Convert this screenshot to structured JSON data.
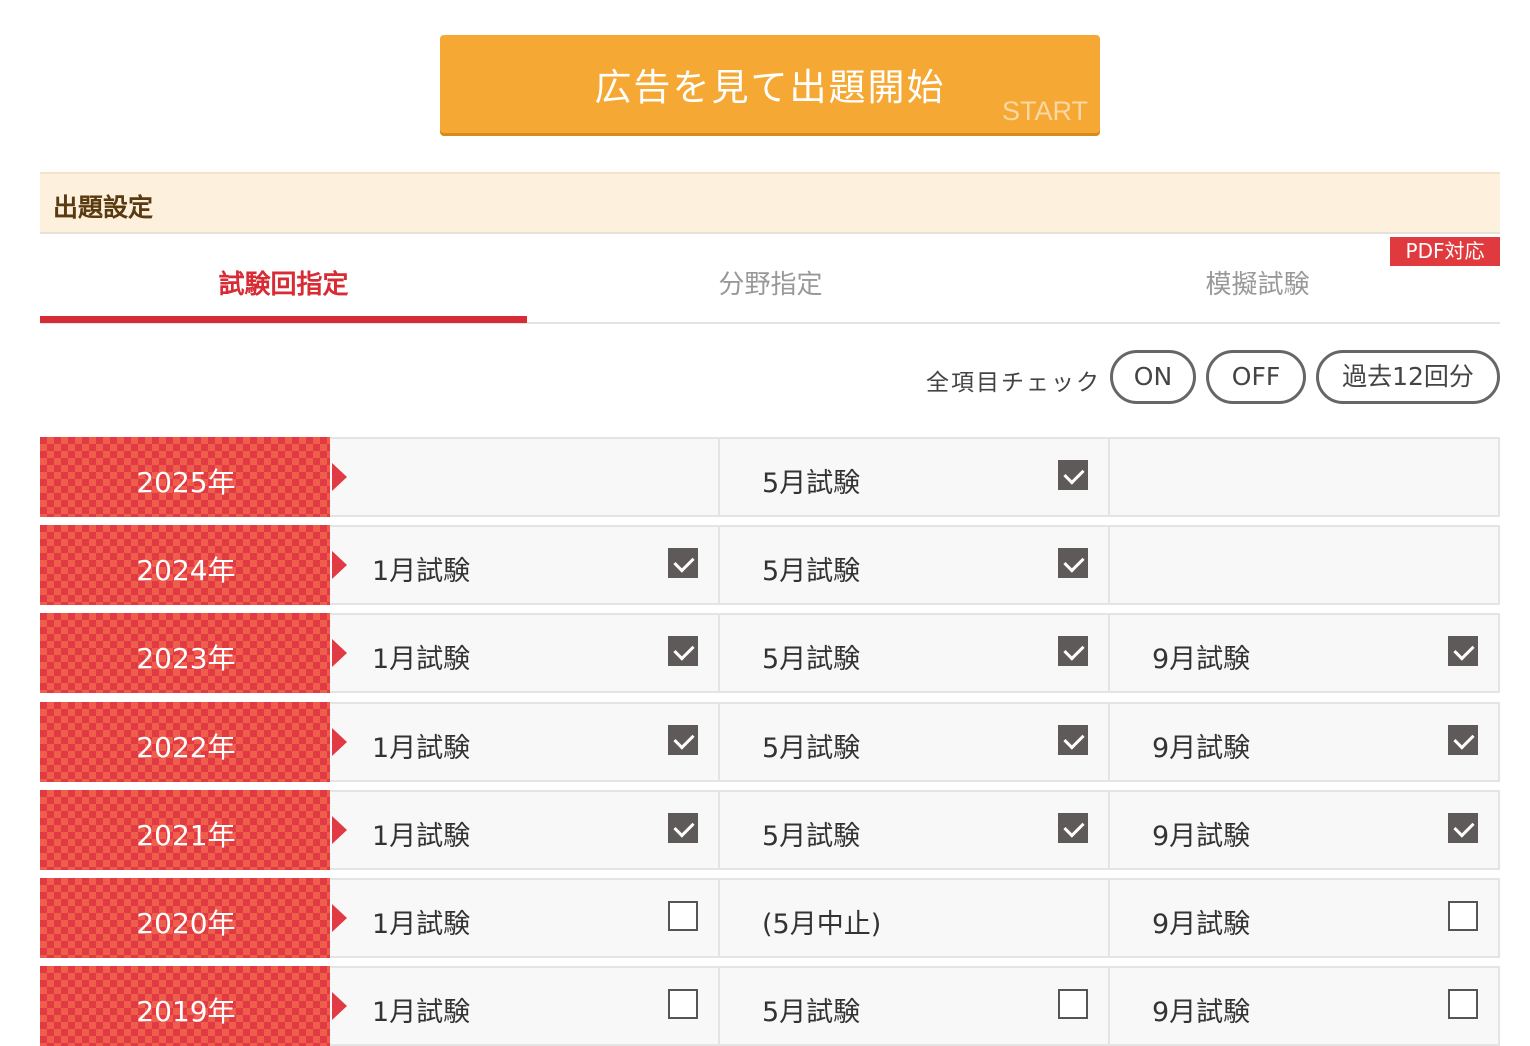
{
  "start_button": {
    "label": "広告を見て出題開始",
    "sub_label": "START"
  },
  "settings": {
    "title": "出題設定"
  },
  "tabs": [
    {
      "label": "試験回指定",
      "active": true
    },
    {
      "label": "分野指定",
      "active": false
    },
    {
      "label": "模擬試験",
      "active": false
    }
  ],
  "pdf_badge": "PDF対応",
  "check_all": {
    "label": "全項目チェック",
    "on_label": "ON",
    "off_label": "OFF",
    "past12_label": "過去12回分"
  },
  "colors": {
    "accent_red": "#d72b35",
    "start_orange": "#f5a833",
    "header_bg": "#fdf0dc"
  },
  "exams": [
    {
      "year": "2025年",
      "cells": [
        null,
        {
          "label": "5月試験",
          "checkbox": true,
          "checked": true
        },
        null
      ]
    },
    {
      "year": "2024年",
      "cells": [
        {
          "label": "1月試験",
          "checkbox": true,
          "checked": true
        },
        {
          "label": "5月試験",
          "checkbox": true,
          "checked": true
        },
        null
      ]
    },
    {
      "year": "2023年",
      "cells": [
        {
          "label": "1月試験",
          "checkbox": true,
          "checked": true
        },
        {
          "label": "5月試験",
          "checkbox": true,
          "checked": true
        },
        {
          "label": "9月試験",
          "checkbox": true,
          "checked": true
        }
      ]
    },
    {
      "year": "2022年",
      "cells": [
        {
          "label": "1月試験",
          "checkbox": true,
          "checked": true
        },
        {
          "label": "5月試験",
          "checkbox": true,
          "checked": true
        },
        {
          "label": "9月試験",
          "checkbox": true,
          "checked": true
        }
      ]
    },
    {
      "year": "2021年",
      "cells": [
        {
          "label": "1月試験",
          "checkbox": true,
          "checked": true
        },
        {
          "label": "5月試験",
          "checkbox": true,
          "checked": true
        },
        {
          "label": "9月試験",
          "checkbox": true,
          "checked": true
        }
      ]
    },
    {
      "year": "2020年",
      "cells": [
        {
          "label": "1月試験",
          "checkbox": true,
          "checked": false
        },
        {
          "label": "(5月中止)",
          "checkbox": false,
          "checked": false
        },
        {
          "label": "9月試験",
          "checkbox": true,
          "checked": false
        }
      ]
    },
    {
      "year": "2019年",
      "cells": [
        {
          "label": "1月試験",
          "checkbox": true,
          "checked": false
        },
        {
          "label": "5月試験",
          "checkbox": true,
          "checked": false
        },
        {
          "label": "9月試験",
          "checkbox": true,
          "checked": false
        }
      ]
    }
  ]
}
